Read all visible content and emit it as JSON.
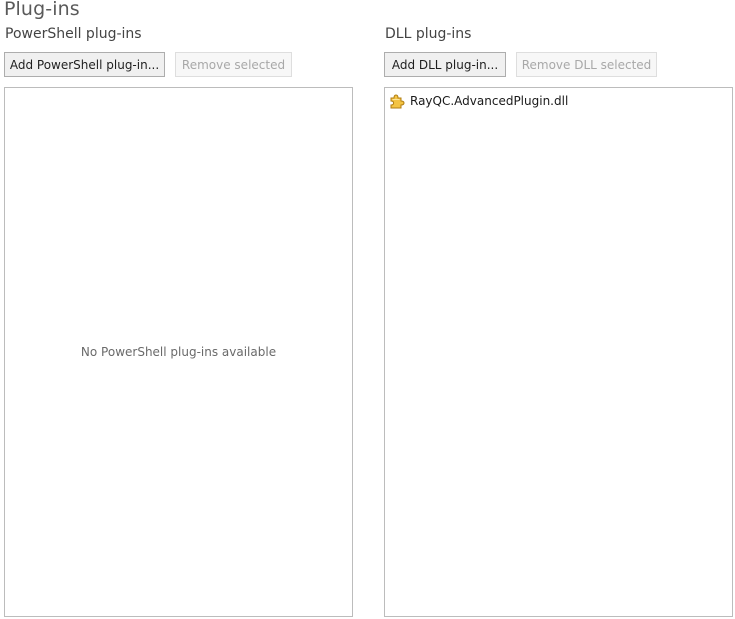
{
  "page": {
    "title": "Plug-ins"
  },
  "powershell": {
    "section_title": "PowerShell plug-ins",
    "add_label": "Add PowerShell plug-in...",
    "remove_label": "Remove selected",
    "empty_message": "No PowerShell plug-ins available",
    "items": []
  },
  "dll": {
    "section_title": "DLL plug-ins",
    "add_label": "Add DLL plug-in...",
    "remove_label": "Remove DLL selected",
    "items": [
      {
        "name": "RayQC.AdvancedPlugin.dll",
        "icon": "puzzle-piece-icon"
      }
    ]
  },
  "colors": {
    "icon_fill": "#f3c343",
    "icon_stroke": "#b07d12"
  }
}
